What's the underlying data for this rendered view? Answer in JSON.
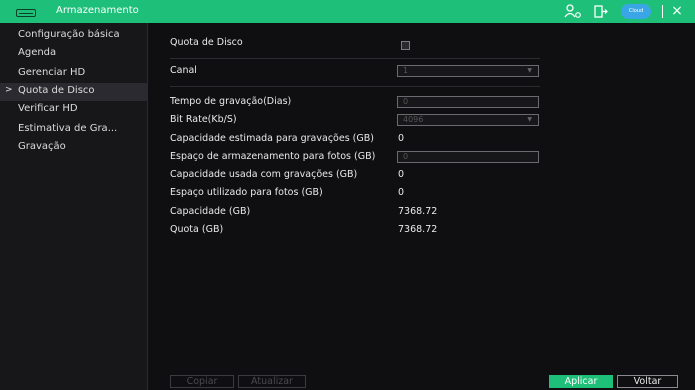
{
  "window": {
    "title": "Armazenamento",
    "icons": {
      "user": "user-settings-icon",
      "exit": "exit-icon",
      "cloud": "Cloud",
      "close": "×"
    }
  },
  "sidebar": {
    "items": [
      {
        "label": "Configuração básica"
      },
      {
        "label": "Agenda"
      },
      {
        "label": "Gerenciar HD"
      },
      {
        "label": "Quota de Disco",
        "active": true
      },
      {
        "label": "Verificar HD"
      },
      {
        "label": "Estimativa de Gra..."
      },
      {
        "label": "Gravação"
      }
    ]
  },
  "form": {
    "quota_label": "Quota de Disco",
    "quota_checked": false,
    "channel_label": "Canal",
    "channel_value": "1",
    "rec_time_label": "Tempo de gravação(Dias)",
    "rec_time_value": "0",
    "bitrate_label": "Bit Rate(Kb/S)",
    "bitrate_value": "4096",
    "est_capacity_label": "Capacidade estimada para gravações (GB)",
    "est_capacity_value": "0",
    "photo_space_label": "Espaço de armazenamento para fotos (GB)",
    "photo_space_value": "0",
    "used_rec_label": "Capacidade usada com gravações (GB)",
    "used_rec_value": "0",
    "used_photo_label": "Espaço utilizado para fotos (GB)",
    "used_photo_value": "0",
    "capacity_label": "Capacidade (GB)",
    "capacity_value": "7368.72",
    "quota_total_label": "Quota (GB)",
    "quota_total_value": "7368.72"
  },
  "buttons": {
    "copy": "Copiar",
    "refresh": "Atualizar",
    "apply": "Aplicar",
    "back": "Voltar"
  },
  "colors": {
    "accent": "#1ec079",
    "background": "#0f0f11",
    "cloud": "#3aa6e6"
  }
}
